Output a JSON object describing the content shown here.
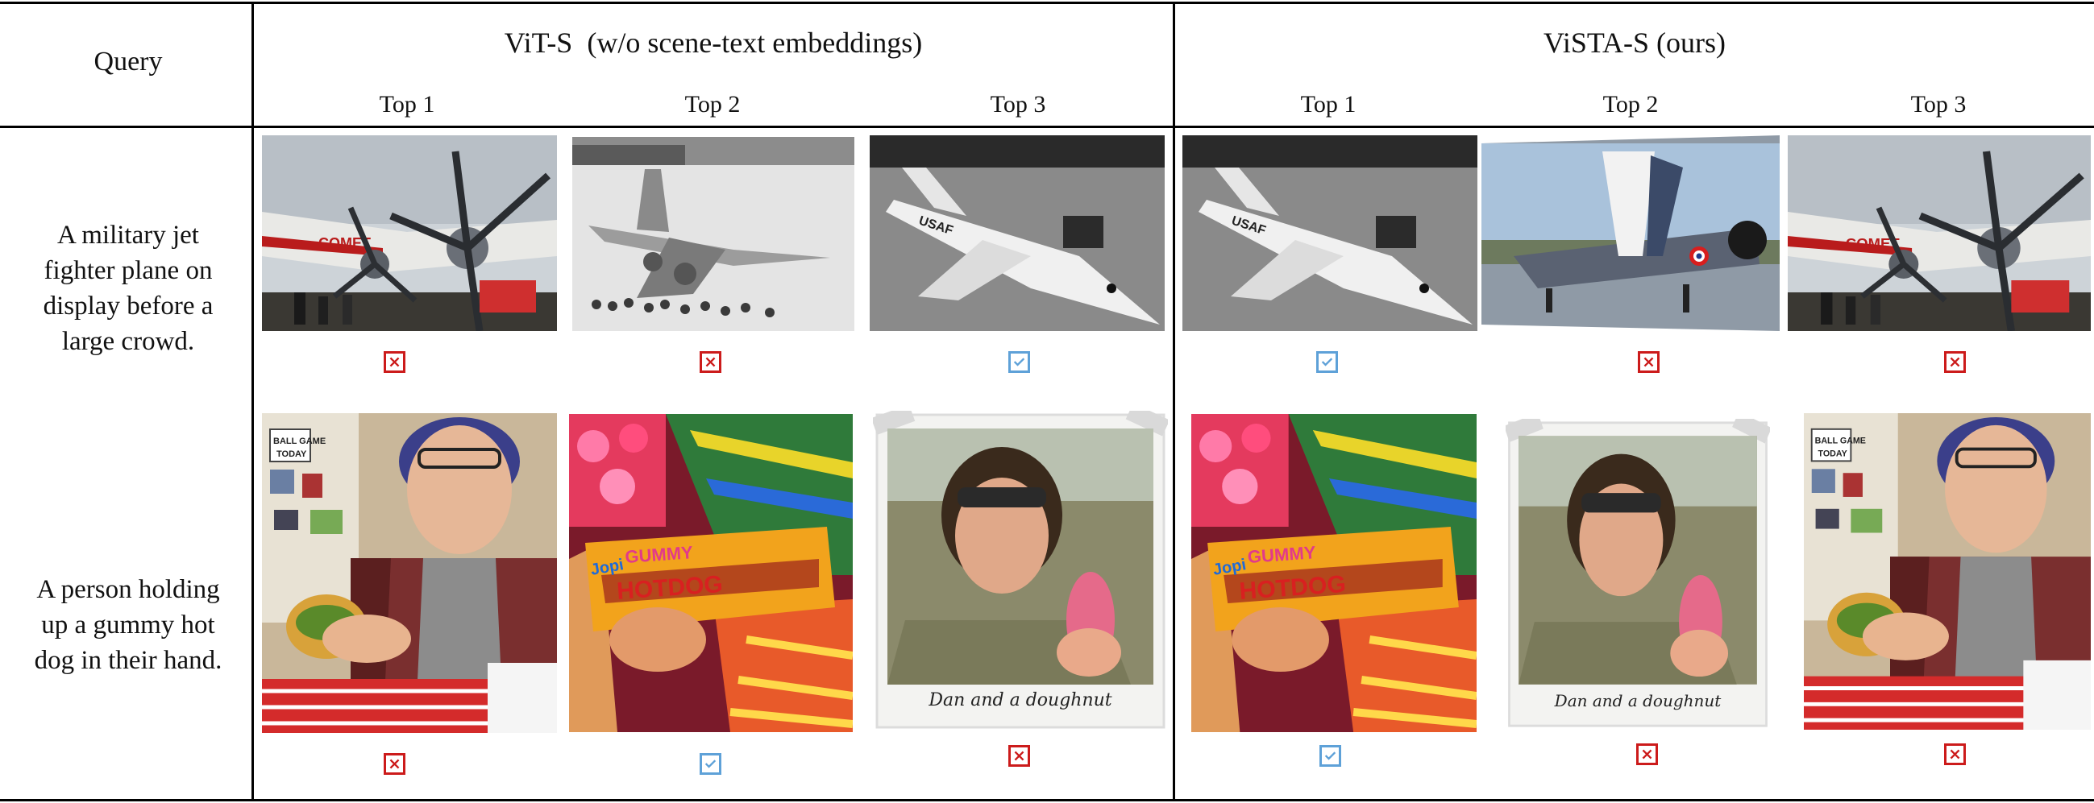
{
  "header": {
    "query_label": "Query",
    "group_vit": "ViT-S  (w/o scene-text embeddings)",
    "group_vista": "ViSTA-S (ours)",
    "top1": "Top 1",
    "top2": "Top 2",
    "top3": "Top 3"
  },
  "rows": [
    {
      "query_lines": [
        "A military jet",
        "fighter plane on",
        "display before a",
        "large crowd."
      ],
      "results": [
        {
          "image": "propeller-airliner-photo",
          "correct": false
        },
        {
          "image": "vintage-jet-with-crew-photo",
          "correct": false
        },
        {
          "image": "usaf-jet-model-bw-photo",
          "correct": true
        },
        {
          "image": "usaf-jet-model-bw-photo",
          "correct": true
        },
        {
          "image": "navy-jet-airshow-photo",
          "correct": false
        },
        {
          "image": "propeller-airliner-photo",
          "correct": false
        }
      ]
    },
    {
      "query_lines": [
        "A person holding",
        "up a gummy hot",
        "dog in their hand."
      ],
      "results": [
        {
          "image": "man-eating-hotdog-photo",
          "correct": false
        },
        {
          "image": "gummy-hotdog-candy-photo",
          "correct": true
        },
        {
          "image": "man-with-doughnut-polaroid-photo",
          "correct": false,
          "caption": "Dan and a doughnut"
        },
        {
          "image": "gummy-hotdog-candy-photo",
          "correct": true
        },
        {
          "image": "man-with-doughnut-polaroid-photo",
          "correct": false,
          "caption": "Dan and a doughnut"
        },
        {
          "image": "man-eating-hotdog-photo",
          "correct": false
        }
      ]
    }
  ],
  "image_text": {
    "usaf": "USAF",
    "comet": "COMET",
    "ball_game": "BALL GAME",
    "today": "TODAY",
    "gummy": "GUMMY",
    "hotdog": "HOTDOG",
    "brand": "Jopi"
  },
  "colors": {
    "wrong": "#cc1b1b",
    "right": "#5ea1d8",
    "rule": "#000000"
  }
}
